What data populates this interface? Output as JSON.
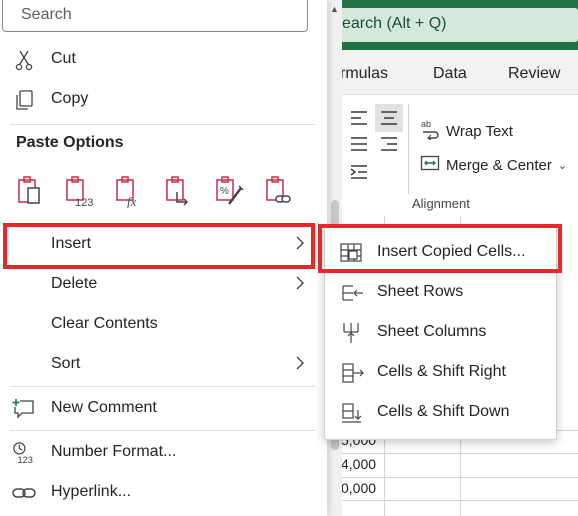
{
  "excel": {
    "search_text": "earch (Alt + Q)",
    "tabs": [
      "rmulas",
      "Data",
      "Review"
    ],
    "wrap_text": "Wrap Text",
    "merge_center": "Merge & Center",
    "group_label": "Alignment",
    "cell_values": [
      "5,000",
      "4,000",
      "0,000"
    ],
    "accent_color": "#217346"
  },
  "context_menu": {
    "search_placeholder": "Search",
    "cut": "Cut",
    "copy": "Copy",
    "paste_options_title": "Paste Options",
    "paste_options": [
      {
        "name": "paste-icon"
      },
      {
        "name": "paste-values-icon"
      },
      {
        "name": "paste-formulas-icon"
      },
      {
        "name": "paste-transpose-icon"
      },
      {
        "name": "paste-formatting-icon"
      },
      {
        "name": "paste-link-icon"
      }
    ],
    "insert": "Insert",
    "delete": "Delete",
    "clear_contents": "Clear Contents",
    "sort": "Sort",
    "new_comment": "New Comment",
    "number_format": "Number Format...",
    "hyperlink": "Hyperlink..."
  },
  "insert_submenu": {
    "items": [
      {
        "label": "Insert Copied Cells...",
        "icon": "insert-copied-cells-icon"
      },
      {
        "label": "Sheet Rows",
        "icon": "sheet-rows-icon"
      },
      {
        "label": "Sheet Columns",
        "icon": "sheet-columns-icon"
      },
      {
        "label": "Cells & Shift Right",
        "icon": "cells-shift-right-icon"
      },
      {
        "label": "Cells & Shift Down",
        "icon": "cells-shift-down-icon"
      }
    ]
  },
  "highlight_color": "#e8262b"
}
